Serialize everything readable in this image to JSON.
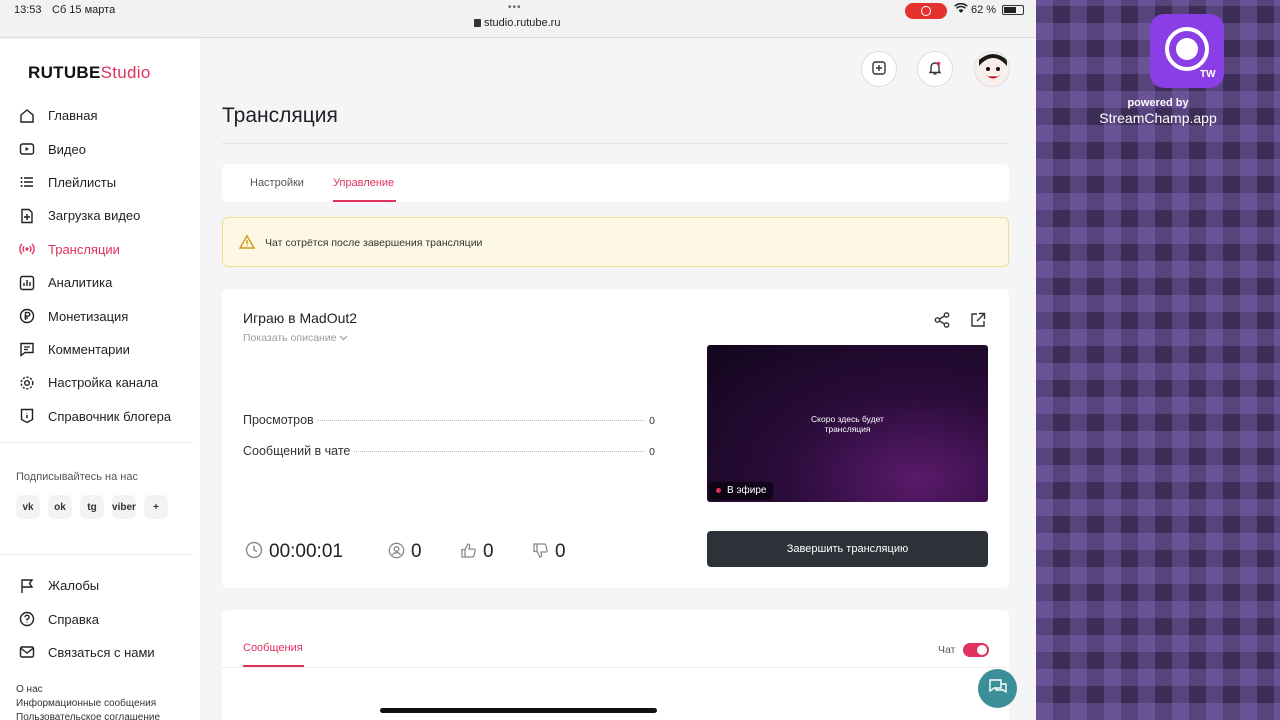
{
  "status_bar": {
    "time": "13:53",
    "date": "Сб 15 марта",
    "dots": "•••",
    "url": "studio.rutube.ru",
    "battery": "62 %"
  },
  "logo": {
    "brand": "RUTUBE",
    "product": "Studio"
  },
  "sidebar": {
    "items": [
      {
        "label": "Главная",
        "icon": "home-icon"
      },
      {
        "label": "Видео",
        "icon": "video-icon"
      },
      {
        "label": "Плейлисты",
        "icon": "playlist-icon"
      },
      {
        "label": "Загрузка видео",
        "icon": "upload-icon"
      },
      {
        "label": "Трансляции",
        "icon": "broadcast-icon",
        "active": true
      },
      {
        "label": "Аналитика",
        "icon": "analytics-icon"
      },
      {
        "label": "Монетизация",
        "icon": "ruble-icon"
      },
      {
        "label": "Комментарии",
        "icon": "comment-icon"
      },
      {
        "label": "Настройка канала",
        "icon": "gear-icon"
      },
      {
        "label": "Справочник блогера",
        "icon": "info-icon"
      }
    ],
    "follow_label": "Подписывайтесь на нас",
    "socials": [
      "vk",
      "ok",
      "tg",
      "viber",
      "+"
    ],
    "secondary": [
      {
        "label": "Жалобы",
        "icon": "flag-icon"
      },
      {
        "label": "Справка",
        "icon": "question-icon"
      },
      {
        "label": "Связаться с нами",
        "icon": "mail-icon"
      }
    ],
    "footer": [
      "О нас",
      "Информационные сообщения",
      "Пользовательское соглашение"
    ]
  },
  "page": {
    "title": "Трансляция",
    "tabs": [
      "Настройки",
      "Управление"
    ],
    "active_tab": "Управление",
    "warning": "Чат сотрётся после завершения трансляции"
  },
  "stream": {
    "title": "Играю в MadOut2",
    "show_description": "Показать описание",
    "stats": [
      {
        "label": "Просмотров",
        "value": "0"
      },
      {
        "label": "Сообщений в чате",
        "value": "0"
      }
    ],
    "timer": "00:00:01",
    "viewers": "0",
    "likes": "0",
    "dislikes": "0",
    "preview_line1": "Скоро здесь будет",
    "preview_line2": "трансляция",
    "live_badge": "В эфире",
    "end_button": "Завершить трансляцию"
  },
  "messages": {
    "tab": "Сообщения",
    "chat_label": "Чат",
    "chat_enabled": true
  },
  "overlay": {
    "app_badge": "TW",
    "powered_by": "powered by",
    "app_name": "StreamChamp.app"
  },
  "colors": {
    "accent": "#e0325d",
    "button_dark": "#2d3138",
    "warning_bg": "#fdf8e4"
  }
}
